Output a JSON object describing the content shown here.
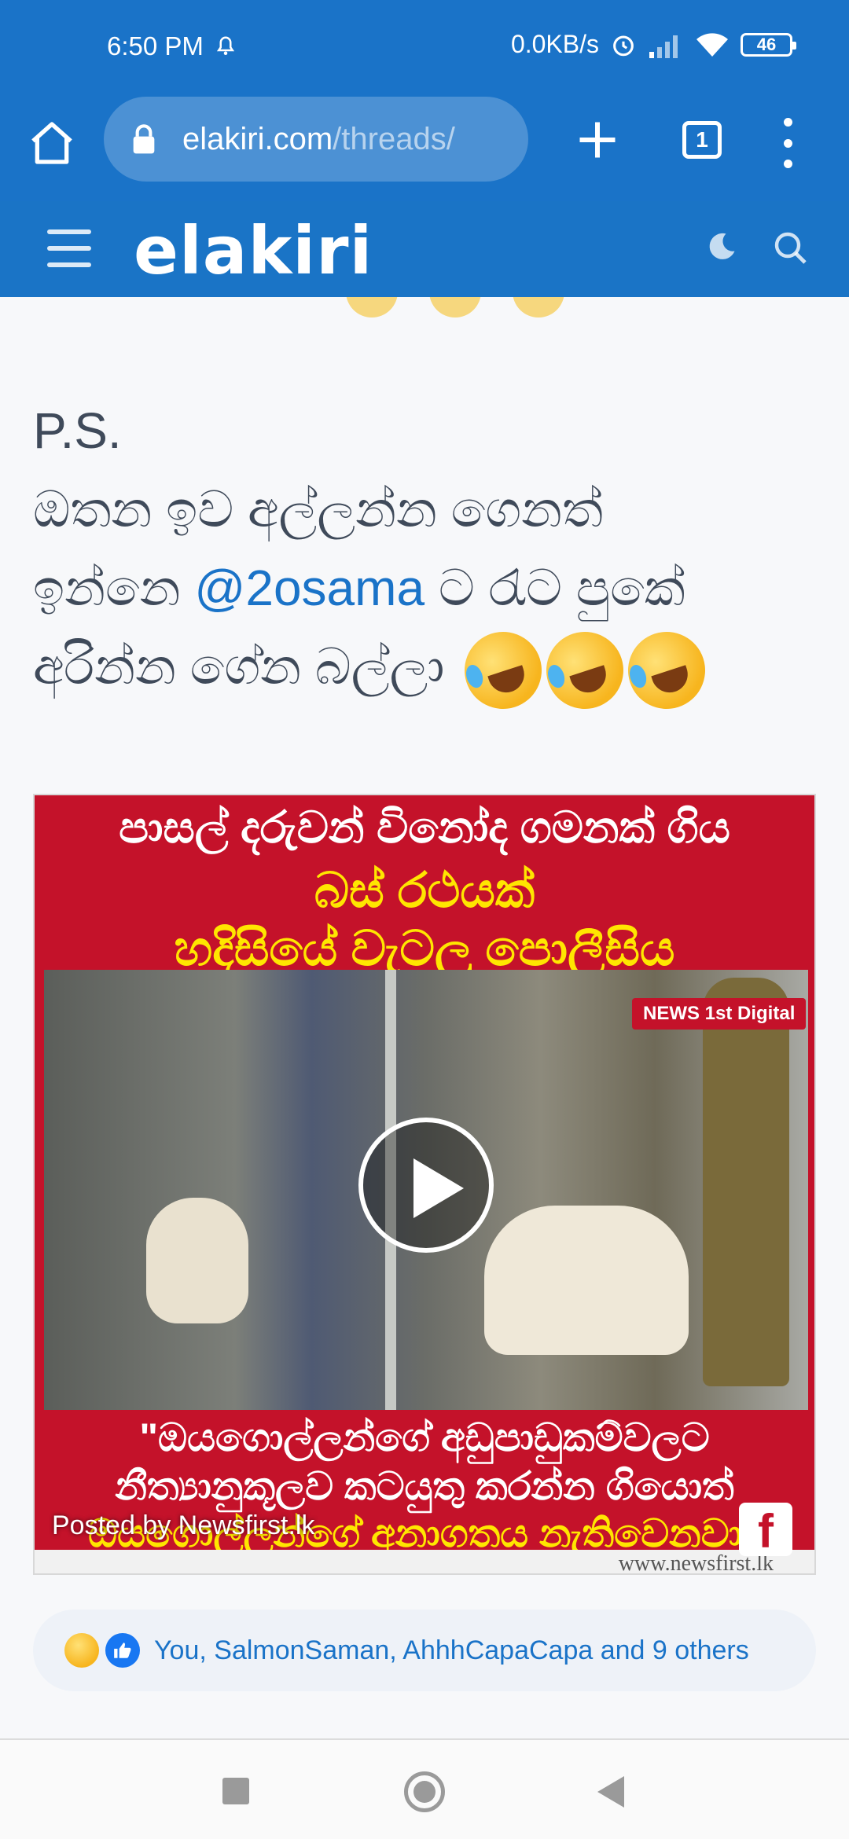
{
  "status_bar": {
    "time": "6:50 PM",
    "network_speed": "0.0KB/s",
    "battery_level": "46",
    "icons": [
      "bell-icon",
      "alarm-icon",
      "signal-icon",
      "wifi-icon",
      "battery-icon"
    ]
  },
  "browser": {
    "url_host": "elakiri.com",
    "url_path": "/threads/",
    "tab_count": "1",
    "icons": [
      "home-icon",
      "lock-icon",
      "plus-icon",
      "tabs-icon",
      "menu-kebab-icon"
    ]
  },
  "site_header": {
    "logo_text": "elakiri",
    "icons": [
      "hamburger-icon",
      "moon-icon",
      "search-icon"
    ]
  },
  "post": {
    "ps_label": "P.S.",
    "line1": "ඔතන ඉව අල්ලන්න ගෙනත්",
    "line2_before": "ඉන්නෙ ",
    "mention": "@2osama",
    "line2_after": " ට රැට පුකේ",
    "line3": "අරින්න ගේන බල්ලා"
  },
  "video": {
    "headline": "පාසල් දරුවන් විනෝද ගමනක් ගිය",
    "subheadline_1": "බස් රථයක්",
    "subheadline_2": "හදිසියේ වැටලූ පොලීසිය",
    "badge": "NEWS 1st Digital",
    "quote_1": "\"ඔයගොල්ලන්ගේ අඩුපාඩුකම්වලට",
    "quote_2": "නීත්‍යානුකූලව කටයුතු කරන්න ගියොත්",
    "quote_3": "ඔයගොල්ලන්ගේ අනාගතය නැතිවෙනවා\"",
    "posted_by": "Posted by Newsfirst.lk",
    "site": "www.newsfirst.lk",
    "fb_letter": "f"
  },
  "reactions": {
    "text": "You, SalmonSaman, AhhhCapaCapa and 9 others"
  },
  "colors": {
    "primary": "#1a73c8",
    "video_red": "#c4122a",
    "headline_yellow": "#ffe600",
    "text": "#3f4a5a"
  }
}
